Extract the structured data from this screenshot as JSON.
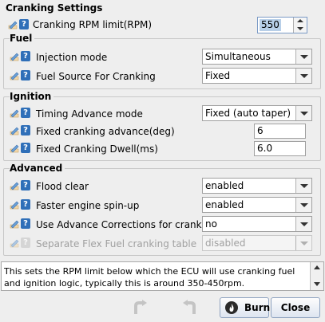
{
  "cranking_settings": {
    "title": "Cranking Settings",
    "rpm_limit_label": "Cranking RPM limit(RPM)",
    "rpm_limit_value": "550"
  },
  "fuel": {
    "title": "Fuel",
    "injection_mode_label": "Injection mode",
    "injection_mode_value": "Simultaneous",
    "fuel_source_label": "Fuel Source For Cranking",
    "fuel_source_value": "Fixed"
  },
  "ignition": {
    "title": "Ignition",
    "timing_mode_label": "Timing Advance mode",
    "timing_mode_value": "Fixed (auto taper)",
    "fixed_advance_label": "Fixed cranking advance(deg)",
    "fixed_advance_value": "6",
    "dwell_label": "Fixed Cranking Dwell(ms)",
    "dwell_value": "6.0"
  },
  "advanced": {
    "title": "Advanced",
    "flood_clear_label": "Flood clear",
    "flood_clear_value": "enabled",
    "faster_spinup_label": "Faster engine spin-up",
    "faster_spinup_value": "enabled",
    "advance_corrections_label": "Use Advance Corrections for cranking",
    "advance_corrections_value": "no",
    "flex_table_label": "Separate Flex Fuel cranking table",
    "flex_table_value": "disabled"
  },
  "help_text": "This sets the RPM limit below which the ECU will use cranking fuel and ignition logic, typically this is around 350-450rpm.",
  "buttons": {
    "burn": "Burn",
    "close": "Close"
  },
  "colors": {
    "help_icon": "#2f6fb8",
    "group_border": "#c8c8c8"
  }
}
